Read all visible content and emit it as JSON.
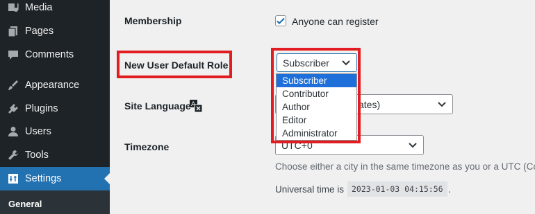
{
  "sidebar": {
    "items": [
      {
        "label": "Media",
        "icon": "media-icon"
      },
      {
        "label": "Pages",
        "icon": "pages-icon"
      },
      {
        "label": "Comments",
        "icon": "comments-icon"
      },
      {
        "label": "Appearance",
        "icon": "appearance-icon"
      },
      {
        "label": "Plugins",
        "icon": "plugins-icon"
      },
      {
        "label": "Users",
        "icon": "users-icon"
      },
      {
        "label": "Tools",
        "icon": "tools-icon"
      },
      {
        "label": "Settings",
        "icon": "settings-icon",
        "active": true
      }
    ],
    "submenu": {
      "label": "General"
    }
  },
  "settings": {
    "membership": {
      "label": "Membership",
      "checkbox_label": "Anyone can register",
      "checked": true
    },
    "default_role": {
      "label": "New User Default Role",
      "selected": "Subscriber",
      "options": [
        "Subscriber",
        "Contributor",
        "Author",
        "Editor",
        "Administrator"
      ]
    },
    "site_language": {
      "label": "Site Language",
      "value_fragment": "ates)"
    },
    "timezone": {
      "label": "Timezone",
      "value": "UTC+0",
      "description": "Choose either a city in the same timezone as you or a UTC (Co",
      "universal_time_label": "Universal time is",
      "universal_time_value": "2023-01-03 04:15:56",
      "universal_time_suffix": "."
    }
  },
  "colors": {
    "sidebar_bg": "#1d2327",
    "accent": "#2271b1",
    "highlight": "#e11d21",
    "selected_option": "#1e6fd9"
  }
}
